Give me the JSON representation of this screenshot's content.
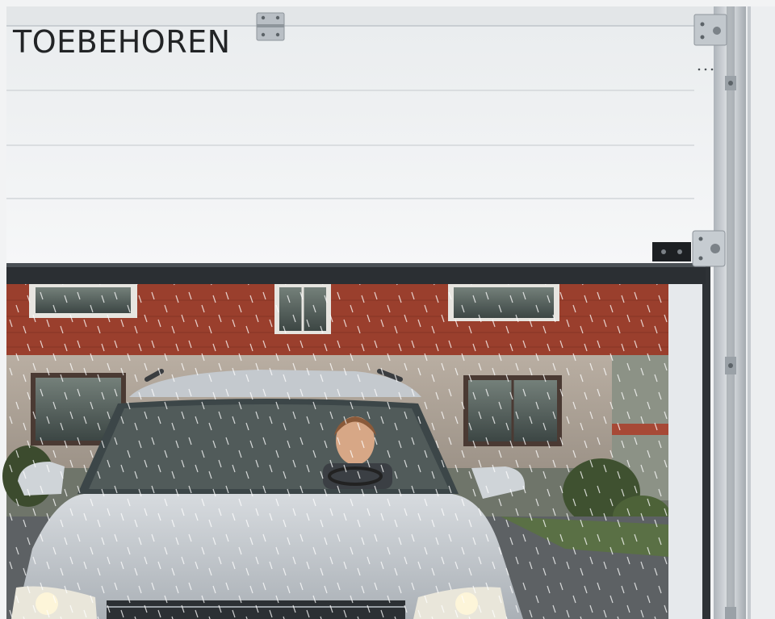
{
  "title": "TOEBEHOREN",
  "image_description": "",
  "colors": {
    "door_panel": "#eef0f1",
    "door_frame_rail": "#c7ccd1",
    "house_brick": "#a74936",
    "roof_tile": "#8e3a29",
    "car_body": "#c9ced3",
    "rain": "#ffffff",
    "title_text": "#222426"
  },
  "icons": [
    "door-hinge-icon",
    "door-roller-bracket-icon"
  ]
}
